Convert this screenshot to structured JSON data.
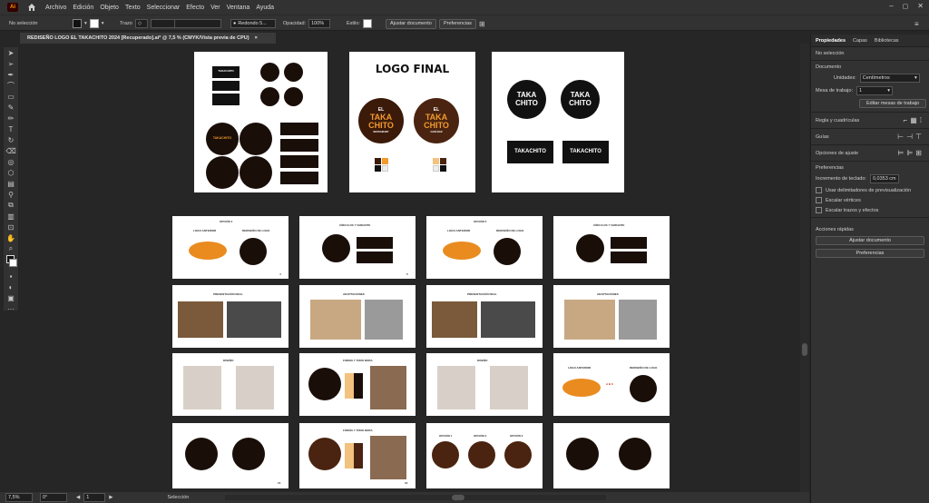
{
  "menubar": {
    "logo": "Ai",
    "items": [
      "Archivo",
      "Edición",
      "Objeto",
      "Texto",
      "Seleccionar",
      "Efecto",
      "Ver",
      "Ventana",
      "Ayuda"
    ]
  },
  "controlbar": {
    "selection": "No selección",
    "stroke_label": "Trazo",
    "brush": "Redondo 5...",
    "opacity_label": "Opacidad:",
    "opacity_value": "100%",
    "style_label": "Estilo:",
    "fit_doc": "Ajustar documento",
    "prefs": "Preferencias"
  },
  "doc_tab": {
    "title": "REDISEÑO LOGO EL TAKACHITO 2024 [Recuperado].ai* @ 7,5 % (CMYK/Vista previa de CPU)",
    "close": "×"
  },
  "artboard2": {
    "title": "LOGO FINAL"
  },
  "logos": {
    "el": "EL",
    "taka": "TAKA",
    "chito": "CHITO",
    "takachito": "TAKACHITO",
    "restaurant": "RESTAURANT",
    "cafebar": "CAFÉ-BAR"
  },
  "slides": {
    "s1": "OPCIÓN 4",
    "s1a": "LOGO ANTERIOR",
    "s1b": "REDISEÑO DE LOGO",
    "s2": "CÍRCULOS Y VARIANTE",
    "s3": "OPCIÓN 5",
    "s5": "PRESENTACIÓN REAL",
    "s6": "ADAPTACIONES",
    "s9": "DISEÑO",
    "s10": "FORMA Y TONO BORA",
    "s13": "OPCIÓN 1",
    "s13b": "OPCIÓN 2",
    "s13c": "OPCIÓN 3",
    "abc": "A B C",
    "p4": "4",
    "p5": "5",
    "p9": "9",
    "p10": "10",
    "p15": "15",
    "p16": "16"
  },
  "panel": {
    "tabs": [
      "Propiedades",
      "Capas",
      "Bibliotecas"
    ],
    "no_selection": "No selección",
    "document": "Documento",
    "units_label": "Unidades:",
    "units_value": "Centímetros",
    "artboard_label": "Mesa de trabajo:",
    "artboard_value": "1",
    "edit_artboards": "Editar mesas de trabajo",
    "rulers": "Regla y cuadrículas",
    "guides": "Guías",
    "snap": "Opciones de ajuste",
    "prefs": "Preferencias",
    "kbd_inc_label": "Incremento de teclado:",
    "kbd_inc_value": "0,0353 cm",
    "chk1": "Usar delimitadores de previsualización",
    "chk2": "Escalar vértices",
    "chk3": "Escalar trazos y efectos",
    "quick_actions": "Acciones rápidas",
    "fit_doc": "Ajustar documento",
    "prefs_btn": "Preferencias"
  },
  "status": {
    "zoom": "7,5%",
    "rotation": "0°",
    "artboard": "1",
    "mode": "Selección"
  }
}
